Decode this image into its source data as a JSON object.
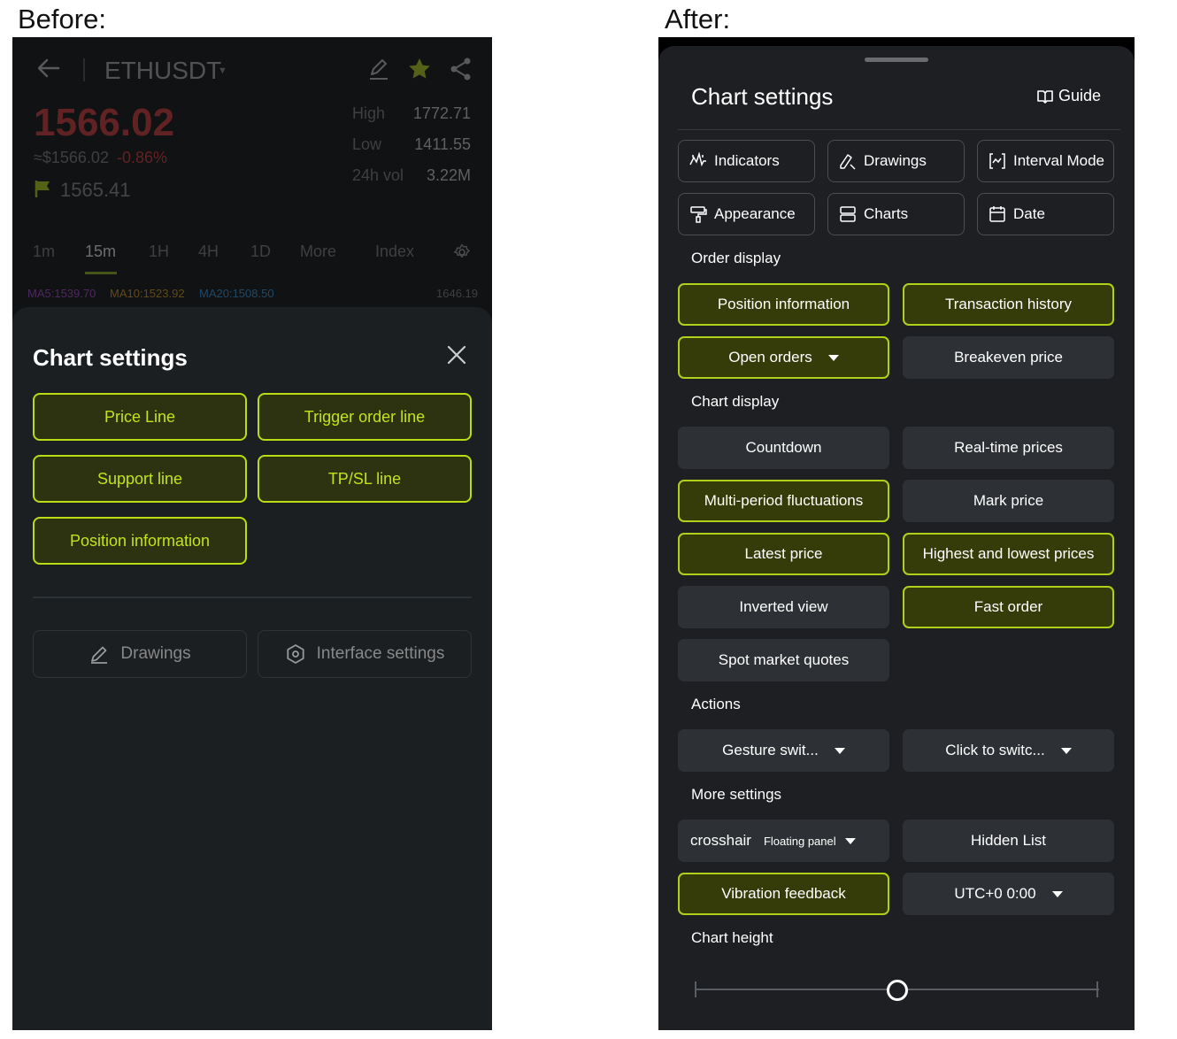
{
  "captions": {
    "before": "Before:",
    "after": "After:"
  },
  "before": {
    "symbol": "ETHUSDT",
    "price": "1566.02",
    "usd_price": "≈$1566.02",
    "change": "-0.86%",
    "flag_value": "1565.41",
    "stats": [
      {
        "label": "High",
        "value": "1772.71"
      },
      {
        "label": "Low",
        "value": "1411.55"
      },
      {
        "label": "24h vol",
        "value": "3.22M"
      }
    ],
    "timeframes": [
      "1m",
      "15m",
      "1H",
      "4H",
      "1D",
      "More",
      "Index"
    ],
    "active_timeframe": "15m",
    "ma": [
      {
        "label": "MA5:1539.70",
        "color": "#b04ad8"
      },
      {
        "label": "MA10:1523.92",
        "color": "#e0a020"
      },
      {
        "label": "MA20:1508.50",
        "color": "#3aa0e8"
      }
    ],
    "axis_value": "1646.19",
    "sheet_title": "Chart settings",
    "toggles": [
      "Price Line",
      "Trigger order line",
      "Support line",
      "TP/SL line",
      "Position information"
    ],
    "drawings_label": "Drawings",
    "interface_label": "Interface settings",
    "colors": {
      "accent": "#b9dc14",
      "down": "#e03c3c"
    }
  },
  "after": {
    "title": "Chart settings",
    "guide_label": "Guide",
    "tools": [
      "Indicators",
      "Drawings",
      "Interval Mode",
      "Appearance",
      "Charts",
      "Date"
    ],
    "order_display": {
      "title": "Order display",
      "buttons": [
        {
          "label": "Position information",
          "on": true
        },
        {
          "label": "Transaction history",
          "on": true
        },
        {
          "label": "Open orders",
          "on": true
        },
        {
          "label": "Breakeven price",
          "on": false
        }
      ]
    },
    "chart_display": {
      "title": "Chart display",
      "buttons": [
        {
          "label": "Countdown",
          "on": false
        },
        {
          "label": "Real-time prices",
          "on": false
        },
        {
          "label": "Multi-period fluctuations",
          "on": true
        },
        {
          "label": "Mark price",
          "on": false
        },
        {
          "label": "Latest price",
          "on": true
        },
        {
          "label": "Highest and lowest prices",
          "on": true
        },
        {
          "label": "Inverted view",
          "on": false
        },
        {
          "label": "Fast order",
          "on": true
        },
        {
          "label": "Spot market quotes",
          "on": false
        }
      ]
    },
    "actions": {
      "title": "Actions",
      "gesture": "Gesture swit...",
      "click": "Click to switc..."
    },
    "more_settings": {
      "title": "More settings",
      "crosshair": "crosshair",
      "crosshair_mode": "Floating panel",
      "hidden_list": "Hidden List",
      "vibration": "Vibration feedback",
      "vibration_on": true,
      "timezone": "UTC+0 0:00"
    },
    "chart_height": {
      "title": "Chart height",
      "value_fraction": 0.5
    },
    "colors": {
      "accent": "#b0d11a",
      "toggle_on_bg": "#363c09",
      "toggle_off_bg": "#2d3034"
    }
  }
}
